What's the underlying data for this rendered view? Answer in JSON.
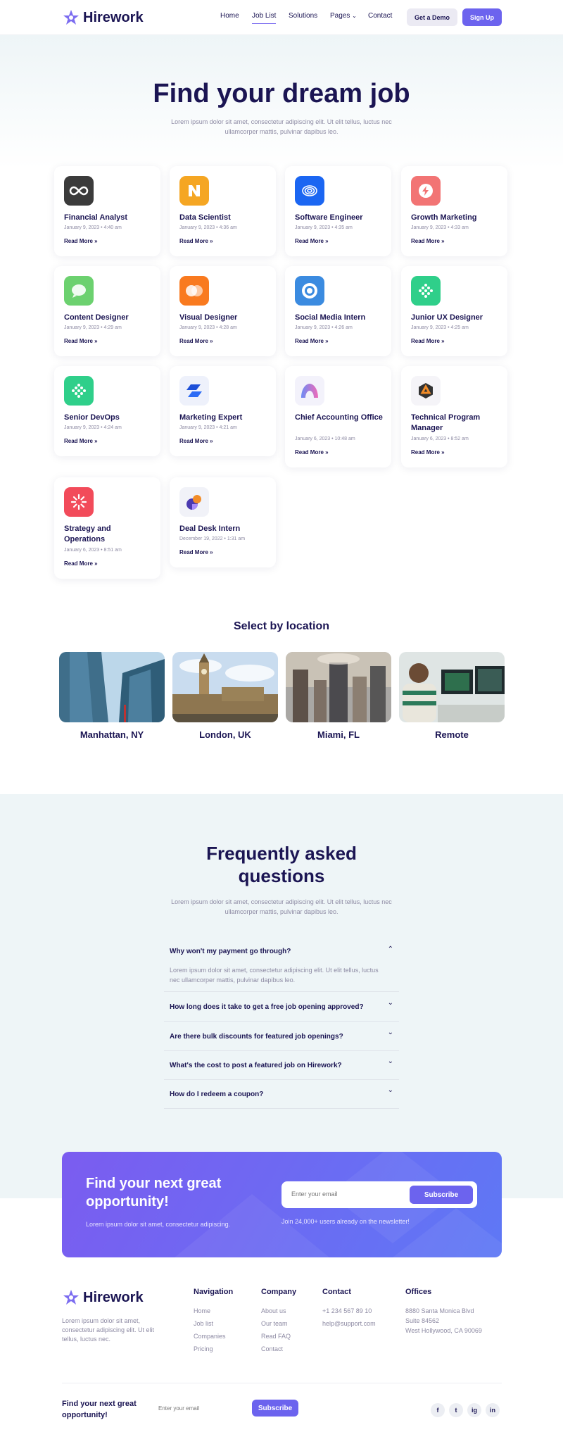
{
  "header": {
    "logo_text": "Hirework",
    "nav": [
      "Home",
      "Job List",
      "Solutions",
      "Pages",
      "Contact"
    ],
    "demo_label": "Get a Demo",
    "signup_label": "Sign Up"
  },
  "hero": {
    "title": "Find your dream job",
    "subtitle": "Lorem ipsum dolor sit amet, consectetur adipiscing elit. Ut elit tellus, luctus nec ullamcorper mattis, pulvinar dapibus leo."
  },
  "jobs": [
    {
      "title": "Financial Analyst",
      "date": "January 9, 2023 • 4:40 am",
      "more": "Read More »",
      "icon": "infinity-icon",
      "color": "#3b3b3b"
    },
    {
      "title": "Data Scientist",
      "date": "January 9, 2023 • 4:36 am",
      "more": "Read More »",
      "icon": "n-logo-icon",
      "color": "#f5a623"
    },
    {
      "title": "Software Engineer",
      "date": "January 9, 2023 • 4:35 am",
      "more": "Read More »",
      "icon": "fingerprint-icon",
      "color": "#1b66f2"
    },
    {
      "title": "Growth Marketing",
      "date": "January 9, 2023 • 4:33 am",
      "more": "Read More »",
      "icon": "bolt-icon",
      "color": "#f27474"
    },
    {
      "title": "Content Designer",
      "date": "January 9, 2023 • 4:29 am",
      "more": "Read More »",
      "icon": "chat-bubble-icon",
      "color": "#6cd16f"
    },
    {
      "title": "Visual Designer",
      "date": "January 9, 2023 • 4:28 am",
      "more": "Read More »",
      "icon": "circles-icon",
      "color": "#f97a1f"
    },
    {
      "title": "Social Media Intern",
      "date": "January 9, 2023 • 4:26 am",
      "more": "Read More »",
      "icon": "target-icon",
      "color": "#3b8be0"
    },
    {
      "title": "Junior UX Designer",
      "date": "January 9, 2023 • 4:25 am",
      "more": "Read More »",
      "icon": "dots-diamond-icon",
      "color": "#2fcf8a"
    },
    {
      "title": "Senior DevOps",
      "date": "January 9, 2023 • 4:24 am",
      "more": "Read More »",
      "icon": "dots-diamond-icon",
      "color": "#2fcf8a"
    },
    {
      "title": "Marketing Expert",
      "date": "January 9, 2023 • 4:21 am",
      "more": "Read More »",
      "icon": "stack-icon",
      "color": "#eef1fb"
    },
    {
      "title": "Chief Accounting Office",
      "date": "January 6, 2023 • 10:48 am",
      "more": "Read More »",
      "icon": "arch-icon",
      "color": "#f3f2fb"
    },
    {
      "title": "Technical Program Manager",
      "date": "January 6, 2023 • 8:52 am",
      "more": "Read More »",
      "icon": "hexagon-icon",
      "color": "#f5f4f8"
    },
    {
      "title": "Strategy and Operations",
      "date": "January 6, 2023 • 8:51 am",
      "more": "Read More »",
      "icon": "burst-icon",
      "color": "#f24b5a"
    },
    {
      "title": "Deal Desk Intern",
      "date": "December 19, 2022 • 1:31 am",
      "more": "Read More »",
      "icon": "pie-icon",
      "color": "#f1f2f8"
    }
  ],
  "locations": {
    "title": "Select by location",
    "items": [
      {
        "name": "Manhattan, NY"
      },
      {
        "name": "London, UK"
      },
      {
        "name": "Miami, FL"
      },
      {
        "name": "Remote"
      }
    ]
  },
  "faq": {
    "title": "Frequently asked questions",
    "subtitle": "Lorem ipsum dolor sit amet, consectetur adipiscing elit. Ut elit tellus, luctus nec ullamcorper mattis, pulvinar dapibus leo.",
    "items": [
      {
        "q": "Why won't my payment go through?",
        "a": "Lorem ipsum dolor sit amet, consectetur adipiscing elit. Ut elit tellus, luctus nec ullamcorper mattis, pulvinar dapibus leo.",
        "open": true
      },
      {
        "q": "How long does it take to get a free job opening approved?"
      },
      {
        "q": "Are there bulk discounts for featured job openings?"
      },
      {
        "q": "What's the cost to post a featured job on Hirework?"
      },
      {
        "q": "How do I redeem a coupon?"
      }
    ]
  },
  "cta": {
    "title": "Find your next great opportunity!",
    "subtitle": "Lorem ipsum dolor sit amet, consectetur adipiscing.",
    "placeholder": "Enter your email",
    "button": "Subscribe",
    "note": "Join 24,000+ users already on the newsletter!"
  },
  "footer": {
    "logo_text": "Hirework",
    "description": "Lorem ipsum dolor sit amet, consectetur adipiscing elit. Ut elit tellus, luctus nec.",
    "navigation": {
      "title": "Navigation",
      "links": [
        "Home",
        "Job list",
        "Companies",
        "Pricing"
      ]
    },
    "company": {
      "title": "Company",
      "links": [
        "About us",
        "Our team",
        "Read FAQ",
        "Contact"
      ]
    },
    "contact": {
      "title": "Contact",
      "links": [
        "+1 234 567 89 10",
        "help@support.com"
      ]
    },
    "offices": {
      "title": "Offices",
      "lines": [
        "8880 Santa Monica Blvd",
        "Suite 84562",
        "West Hollywood, CA 90069"
      ]
    },
    "newsletter_title": "Find your next great opportunity!",
    "placeholder": "Enter your email",
    "button": "Subscribe",
    "social": [
      "f",
      "t",
      "ig",
      "in"
    ]
  }
}
